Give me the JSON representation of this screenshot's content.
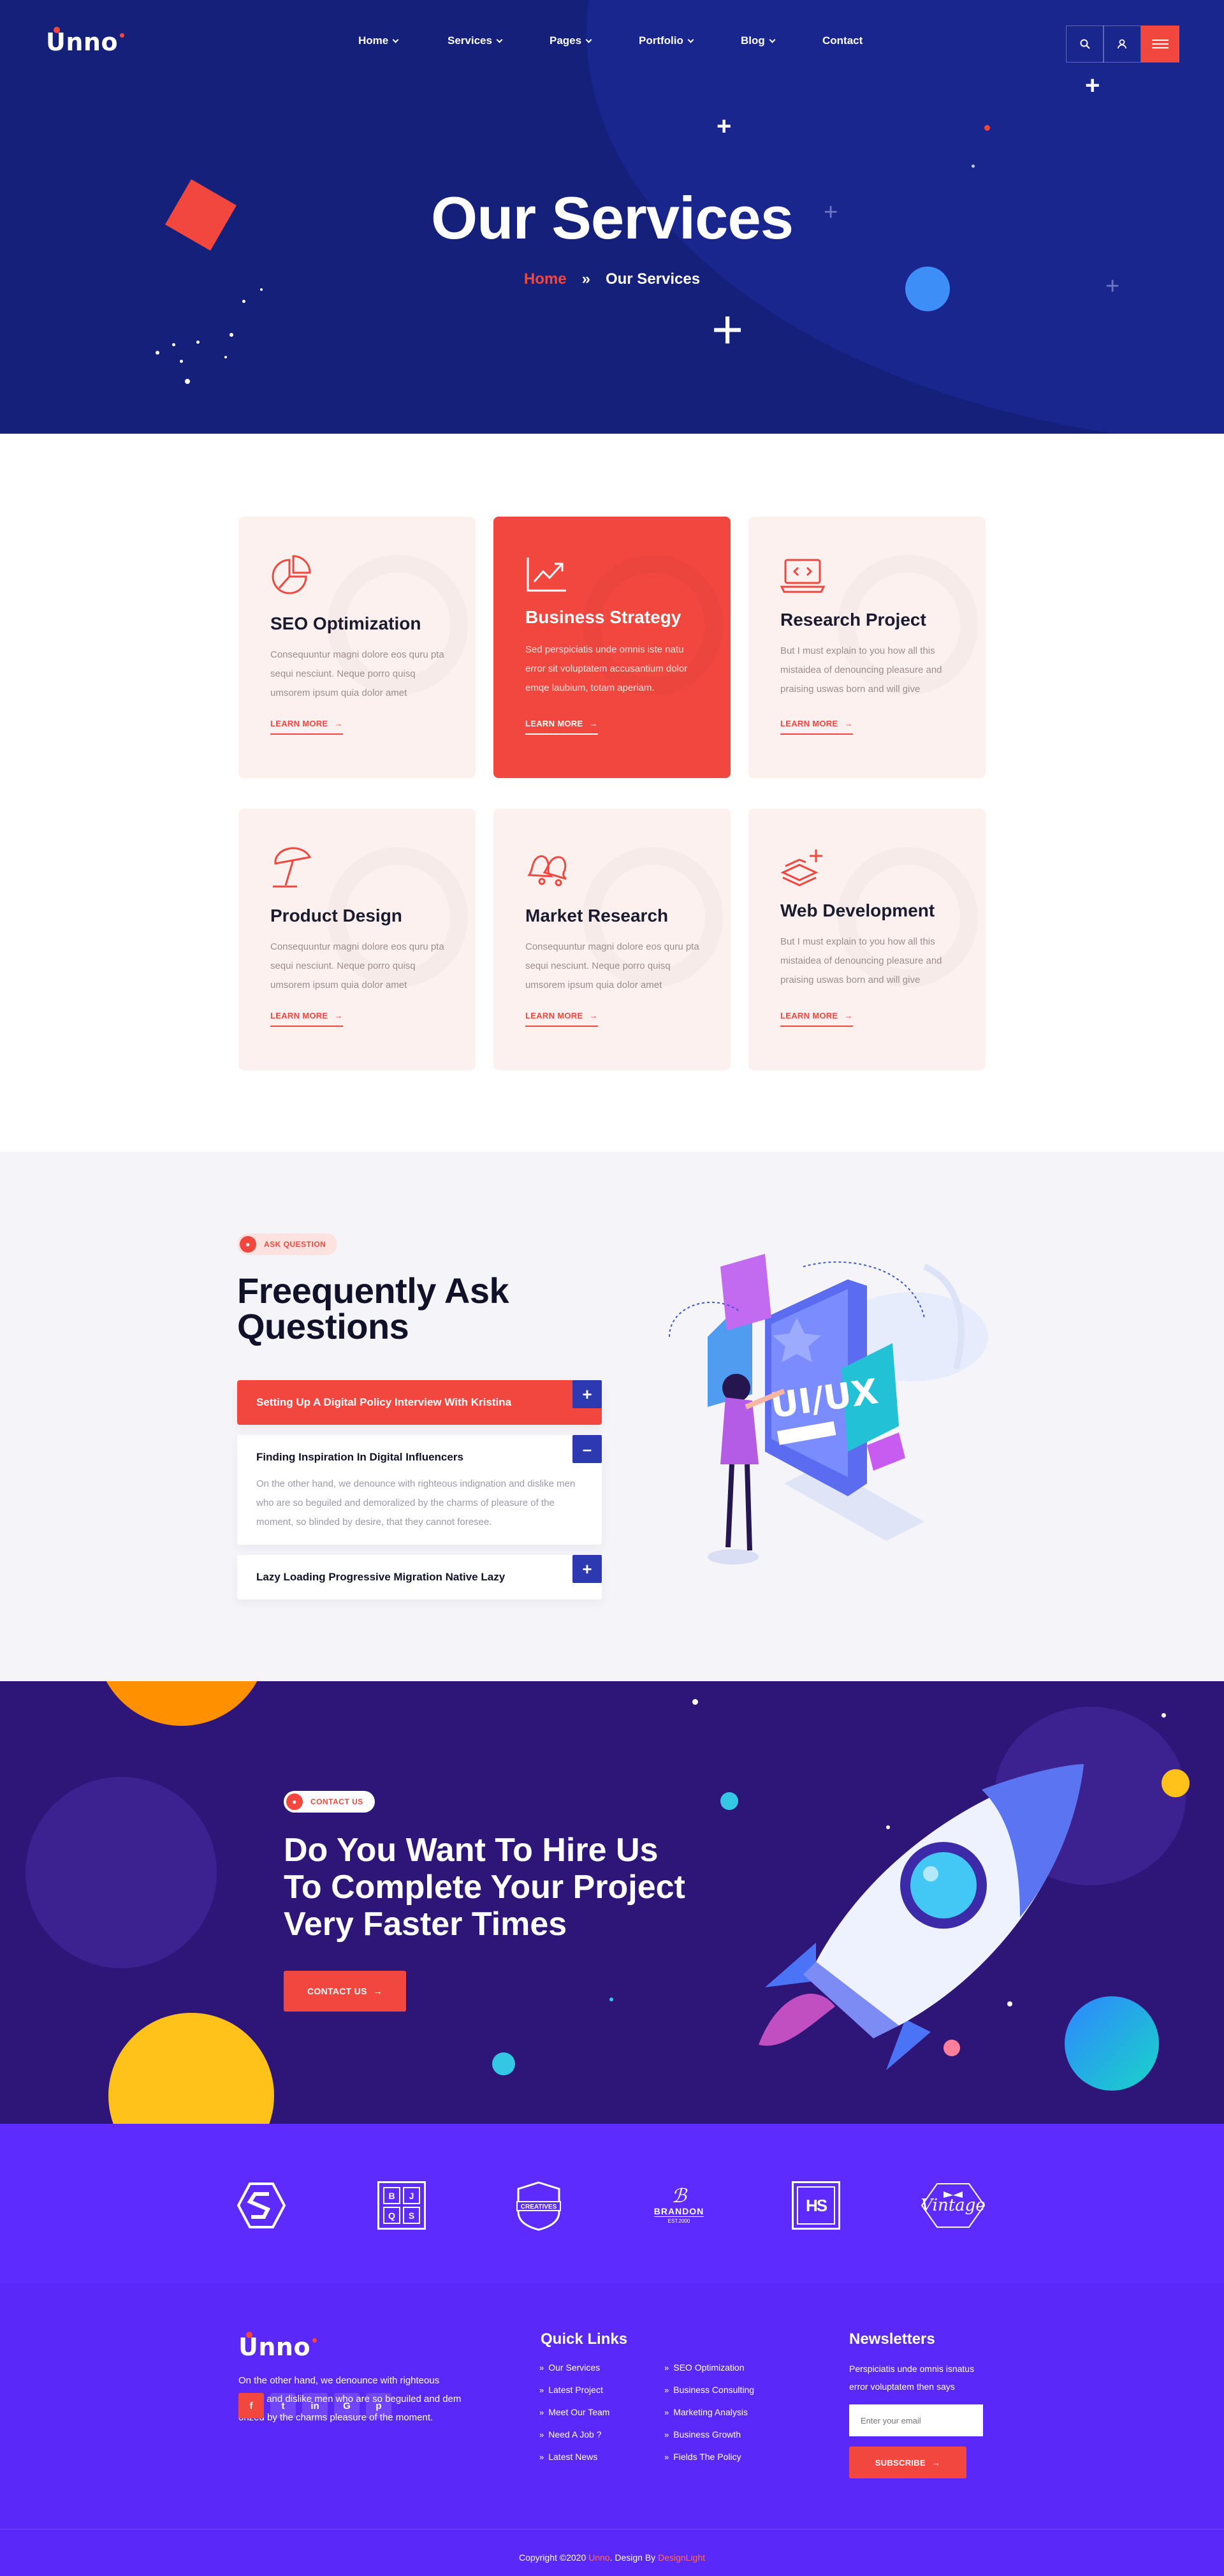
{
  "brand": {
    "logo_text": "Unno"
  },
  "nav": {
    "items": [
      {
        "label": "Home",
        "dropdown": true
      },
      {
        "label": "Services",
        "dropdown": true
      },
      {
        "label": "Pages",
        "dropdown": true
      },
      {
        "label": "Portfolio",
        "dropdown": true
      },
      {
        "label": "Blog",
        "dropdown": true
      },
      {
        "label": "Contact",
        "dropdown": false
      }
    ],
    "icons": [
      "search-icon",
      "user-icon",
      "menu-icon"
    ]
  },
  "hero": {
    "title": "Our Services",
    "breadcrumb": {
      "home": "Home",
      "separator": "»",
      "current": "Our Services"
    }
  },
  "services": [
    {
      "title": "SEO Optimization",
      "text": "Consequuntur magni dolore eos quru pta sequi nesciunt. Neque porro quisq umsorem ipsum quia dolor  amet",
      "link": "LEARN MORE",
      "icon": "pie-chart-icon",
      "active": false
    },
    {
      "title": "Business Strategy",
      "text": "Sed perspiciatis unde omnis iste natu error sit voluptatem accusantium dolor emqe laubium, totam aperiam.",
      "link": "LEARN MORE",
      "icon": "trend-chart-icon",
      "active": true
    },
    {
      "title": "Research Project",
      "text": "But I must explain to you how all this mistaidea of denouncing pleasure and praising uswas born and will give",
      "link": "LEARN MORE",
      "icon": "laptop-code-icon",
      "active": false
    },
    {
      "title": "Product Design",
      "text": "Consequuntur magni dolore eos quru pta sequi nesciunt. Neque porro quisq umsorem ipsum quia dolor  amet",
      "link": "LEARN MORE",
      "icon": "umbrella-icon",
      "active": false
    },
    {
      "title": "Market Research",
      "text": "Consequuntur magni dolore eos quru pta sequi nesciunt. Neque porro quisq umsorem ipsum quia dolor  amet",
      "link": "LEARN MORE",
      "icon": "bells-icon",
      "active": false
    },
    {
      "title": "Web Development",
      "text": "But I must explain to you how all this mistaidea of denouncing pleasure and praising uswas born and will give",
      "link": "LEARN MORE",
      "icon": "layers-plus-icon",
      "active": false
    }
  ],
  "faq": {
    "badge": "ASK QUESTION",
    "title_line1": "Freequently Ask",
    "title_line2": "Questions",
    "items": [
      {
        "question": "Setting Up A Digital Policy Interview With Kristina",
        "toggle": "+",
        "state": "highlighted"
      },
      {
        "question": "Finding Inspiration In Digital Influencers",
        "toggle": "–",
        "state": "open",
        "answer": "On the other hand, we denounce with righteous indignation and dislike men who are so beguiled and demoralized by the charms of pleasure of the moment, so blinded by desire, that they cannot foresee."
      },
      {
        "question": "Lazy Loading Progressive Migration Native Lazy",
        "toggle": "+",
        "state": "closed"
      }
    ],
    "illustration_text": "UI/UX"
  },
  "hire": {
    "badge": "CONTACT US",
    "title_line1": "Do You Want To Hire Us",
    "title_line2": "To Complete Your Project",
    "title_line3": "Very Faster Times",
    "button": "CONTACT US"
  },
  "brands": [
    {
      "name": "s-logo-icon"
    },
    {
      "name": "bjqs-logo-icon",
      "letters": [
        "B",
        "J",
        "Q",
        "S"
      ]
    },
    {
      "name": "creatives-logo-icon",
      "text": "CREATIVES"
    },
    {
      "name": "brandon-logo-icon",
      "text": "BRANDON",
      "sub": "EST.2000"
    },
    {
      "name": "hs-logo-icon",
      "text": "HS"
    },
    {
      "name": "vintage-logo-icon",
      "text": "Vintage"
    }
  ],
  "footer": {
    "logo_text": "Unno",
    "about_line1": "On the other hand, we denounce with righteous",
    "about_line2": "indign and dislike men who are so beguiled and dem",
    "about_line3": "orized by the charms pleasure of the moment.",
    "social": [
      "f",
      "t",
      "in",
      "G",
      "p"
    ],
    "quick_links_title": "Quick Links",
    "quick_links_col1": [
      "Our Services",
      "Latest Project",
      "Meet Our Team",
      "Need A Job ?",
      "Latest News"
    ],
    "quick_links_col2": [
      "SEO Optimization",
      "Business Consulting",
      "Marketing Analysis",
      "Business Growth",
      "Fields The Policy"
    ],
    "newsletter_title": "Newsletters",
    "newsletter_text_line1": "Perspiciatis unde omnis isnatus",
    "newsletter_text_line2": "error voluptatem then says",
    "email_placeholder": "Enter your email",
    "subscribe_button": "SUBSCRIBE",
    "copyright_prefix": "Copyright ©2020 ",
    "copyright_brand": "Unno",
    "copyright_mid": ". Design By ",
    "copyright_author": "DesignLight"
  },
  "colors": {
    "accent": "#f2473f",
    "hero_bg": "#14207a",
    "hire_bg": "#2e1679",
    "footer_bg": "#5a28f8",
    "faq_bg": "#f5f5f9",
    "card_bg": "#fdf1ef",
    "toggle_blue": "#2d39b0"
  }
}
